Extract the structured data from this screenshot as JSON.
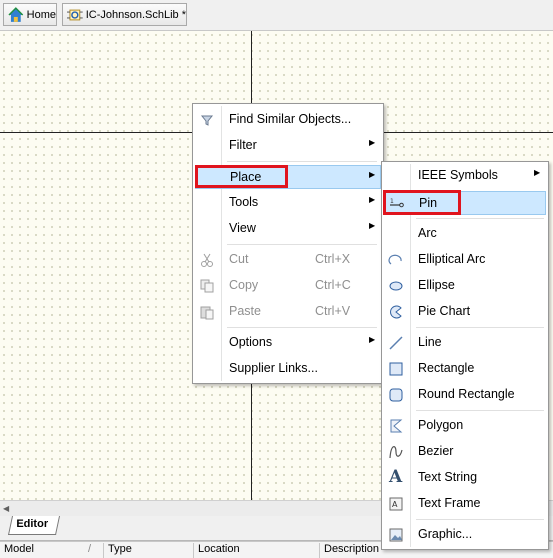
{
  "tabs": {
    "home_label": "Home",
    "doc_label": "IC-Johnson.SchLib *"
  },
  "context_menu": {
    "find_similar": "Find Similar Objects...",
    "filter": "Filter",
    "place": "Place",
    "tools": "Tools",
    "view": "View",
    "cut": "Cut",
    "cut_shortcut": "Ctrl+X",
    "copy": "Copy",
    "copy_shortcut": "Ctrl+C",
    "paste": "Paste",
    "paste_shortcut": "Ctrl+V",
    "options": "Options",
    "supplier_links": "Supplier Links..."
  },
  "place_submenu": {
    "ieee_symbols": "IEEE Symbols",
    "pin": "Pin",
    "arc": "Arc",
    "elliptical_arc": "Elliptical Arc",
    "ellipse": "Ellipse",
    "pie_chart": "Pie Chart",
    "line": "Line",
    "rectangle": "Rectangle",
    "round_rectangle": "Round Rectangle",
    "polygon": "Polygon",
    "bezier": "Bezier",
    "text_string": "Text String",
    "text_frame": "Text Frame",
    "graphic": "Graphic..."
  },
  "bottom": {
    "editor_tab": "Editor",
    "columns": [
      "Model",
      "Type",
      "Location",
      "Description"
    ]
  },
  "colors": {
    "highlight": "#cde8ff",
    "annotation_red": "#e0141e",
    "canvas": "#fdfcf2"
  }
}
